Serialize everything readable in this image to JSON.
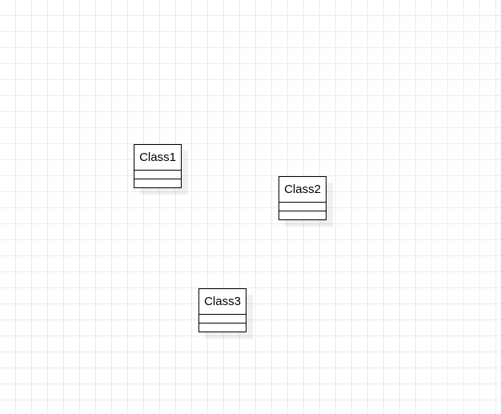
{
  "diagram": {
    "classes": [
      {
        "name": "Class1"
      },
      {
        "name": "Class2"
      },
      {
        "name": "Class3"
      }
    ]
  }
}
